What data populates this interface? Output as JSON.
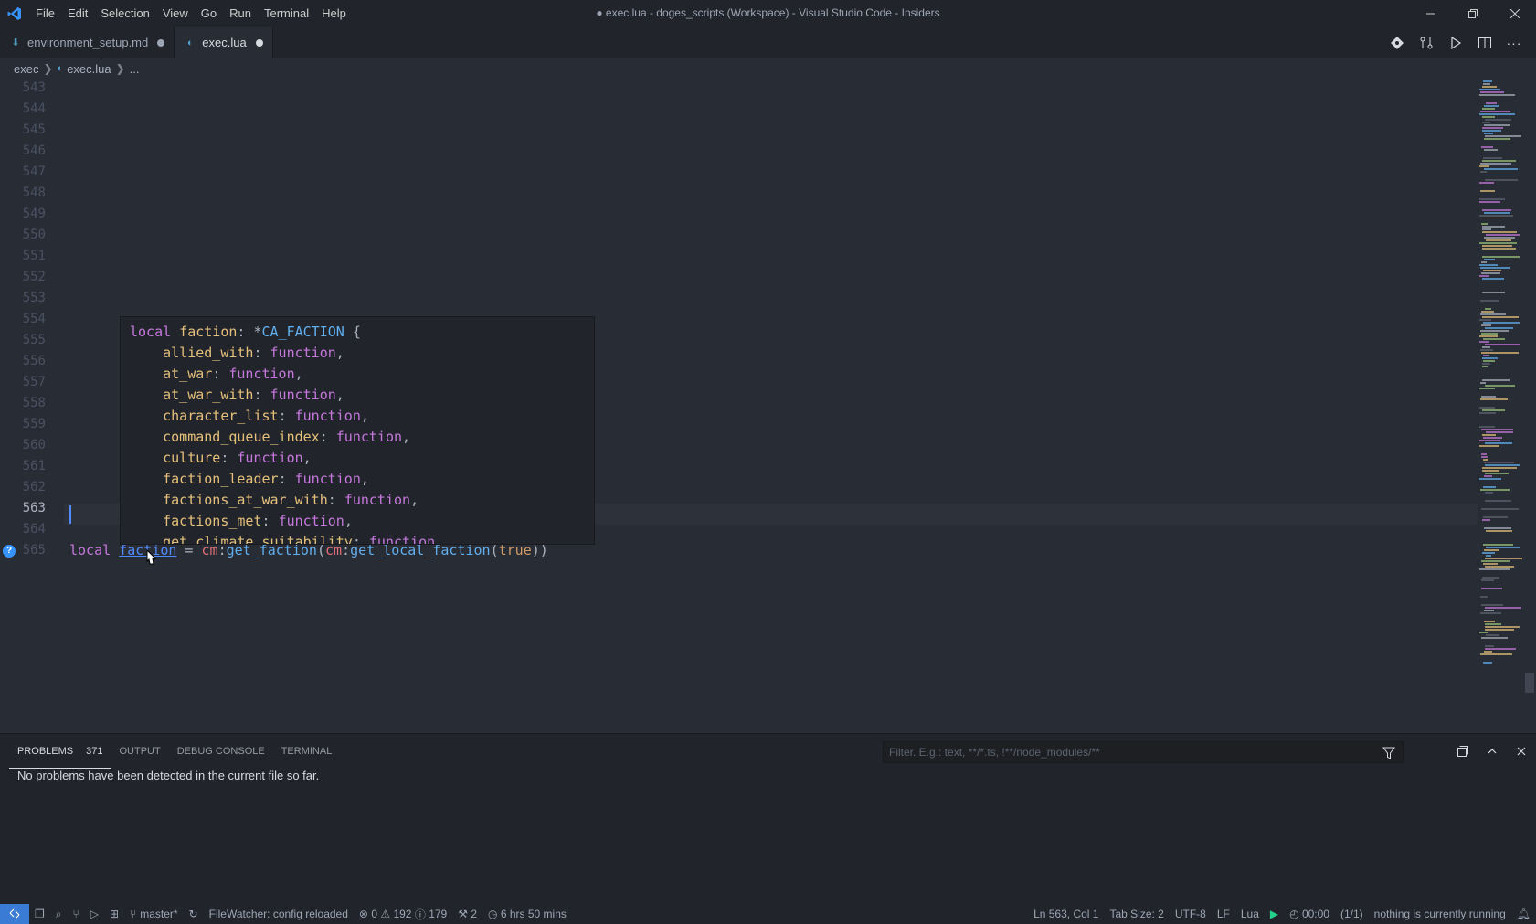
{
  "window": {
    "title": "● exec.lua - doges_scripts (Workspace) - Visual Studio Code - Insiders",
    "menu": [
      "File",
      "Edit",
      "Selection",
      "View",
      "Go",
      "Run",
      "Terminal",
      "Help"
    ]
  },
  "tabs": [
    {
      "label": "environment_setup.md",
      "dirty": true,
      "active": false
    },
    {
      "label": "exec.lua",
      "dirty": true,
      "active": true
    }
  ],
  "breadcrumb": {
    "folder": "exec",
    "file": "exec.lua",
    "more": "..."
  },
  "editor": {
    "line_numbers": [
      "543",
      "544",
      "545",
      "546",
      "547",
      "548",
      "549",
      "550",
      "551",
      "552",
      "553",
      "554",
      "555",
      "556",
      "557",
      "558",
      "559",
      "560",
      "561",
      "562",
      "563",
      "564",
      "565"
    ],
    "current_line": "563",
    "code_565": {
      "kw": "local",
      "var": "faction",
      "eq": " = ",
      "obj": "cm",
      "colon1": ":",
      "fn1": "get_faction",
      "paren1": "(",
      "obj2": "cm",
      "colon2": ":",
      "fn2": "get_local_faction",
      "paren2": "(",
      "bool": "true",
      "close": "))"
    },
    "hover": {
      "header_kw": "local",
      "header_name": "faction",
      "header_sep": ": *",
      "header_type": "CA_FACTION",
      "header_brace": " {",
      "props": [
        {
          "name": "allied_with",
          "type": "function"
        },
        {
          "name": "at_war",
          "type": "function"
        },
        {
          "name": "at_war_with",
          "type": "function"
        },
        {
          "name": "character_list",
          "type": "function"
        },
        {
          "name": "command_queue_index",
          "type": "function"
        },
        {
          "name": "culture",
          "type": "function"
        },
        {
          "name": "faction_leader",
          "type": "function"
        },
        {
          "name": "factions_at_war_with",
          "type": "function"
        },
        {
          "name": "factions_met",
          "type": "function"
        },
        {
          "name": "get_climate_suitability",
          "type": "function"
        }
      ]
    }
  },
  "panel": {
    "tabs": [
      "PROBLEMS",
      "OUTPUT",
      "DEBUG CONSOLE",
      "TERMINAL"
    ],
    "problems_count": "371",
    "filter_placeholder": "Filter. E.g.: text, **/*.ts, !**/node_modules/**",
    "message": "No problems have been detected in the current file so far."
  },
  "statusbar": {
    "branch": "master*",
    "filewatcher": "FileWatcher: config reloaded",
    "errors": "0",
    "warnings": "192",
    "infos": "179",
    "tools": "2",
    "time_tracked": "6 hrs 50 mins",
    "position": "Ln 563, Col 1",
    "tab_size": "Tab Size: 2",
    "encoding": "UTF-8",
    "eol": "LF",
    "language": "Lua",
    "timer": "00:00",
    "count": "(1/1)",
    "running": "nothing is currently running"
  }
}
